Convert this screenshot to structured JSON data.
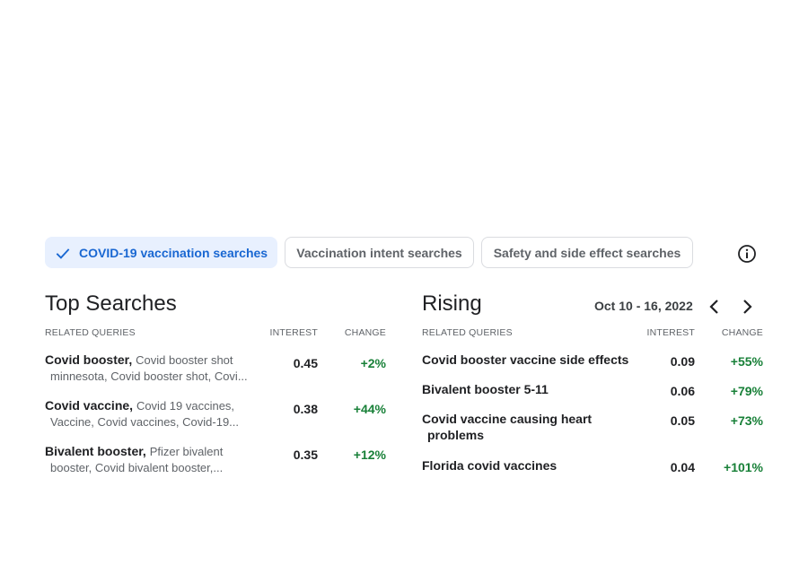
{
  "chips": [
    {
      "label": "COVID-19 vaccination searches",
      "selected": true
    },
    {
      "label": "Vaccination intent searches",
      "selected": false
    },
    {
      "label": "Safety and side effect searches",
      "selected": false
    }
  ],
  "colors": {
    "accent": "#1967d2",
    "chip_bg": "#e8f0fe",
    "positive": "#188038",
    "muted": "#5f6368"
  },
  "top": {
    "title": "Top Searches",
    "columns": {
      "query": "RELATED QUERIES",
      "interest": "INTEREST",
      "change": "CHANGE"
    },
    "rows": [
      {
        "main": "Covid booster,",
        "sub1": "Covid booster shot",
        "sub2": "minnesota, Covid booster shot, Covi...",
        "interest": "0.45",
        "change": "+2%"
      },
      {
        "main": "Covid vaccine,",
        "sub1": "Covid 19 vaccines,",
        "sub2": "Vaccine, Covid vaccines, Covid-19...",
        "interest": "0.38",
        "change": "+44%"
      },
      {
        "main": "Bivalent booster,",
        "sub1": "Pfizer bivalent",
        "sub2": "booster, Covid bivalent booster,...",
        "interest": "0.35",
        "change": "+12%"
      }
    ]
  },
  "rising": {
    "title": "Rising",
    "date_range": "Oct 10 - 16, 2022",
    "columns": {
      "query": "RELATED QUERIES",
      "interest": "INTEREST",
      "change": "CHANGE"
    },
    "rows": [
      {
        "l1": "Covid booster vaccine side effects",
        "l2": "",
        "interest": "0.09",
        "change": "+55%"
      },
      {
        "l1": "Bivalent booster 5-11",
        "l2": "",
        "interest": "0.06",
        "change": "+79%"
      },
      {
        "l1": "Covid vaccine causing heart",
        "l2": "problems",
        "interest": "0.05",
        "change": "+73%"
      },
      {
        "l1": "Florida covid vaccines",
        "l2": "",
        "interest": "0.04",
        "change": "+101%"
      }
    ]
  },
  "icons": {
    "check": "check-icon",
    "info": "info-icon",
    "prev": "chevron-left-icon",
    "next": "chevron-right-icon"
  }
}
